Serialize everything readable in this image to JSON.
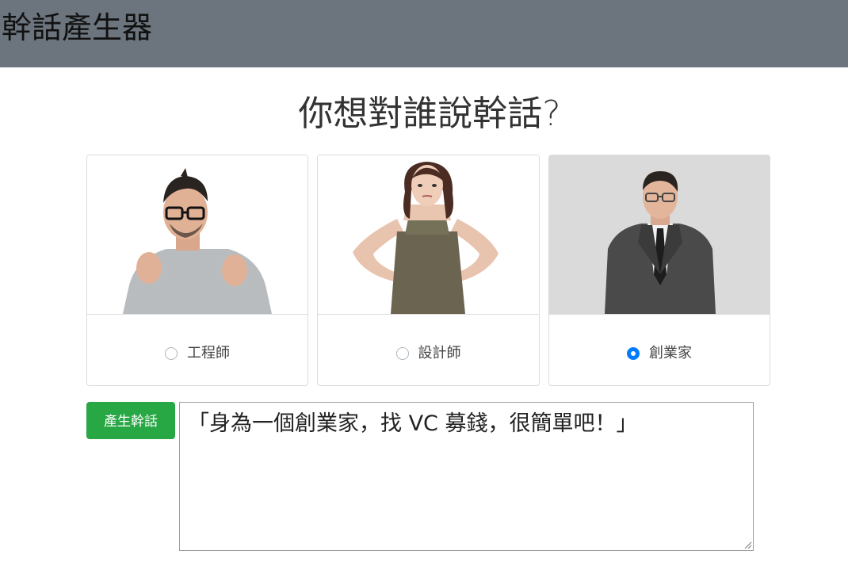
{
  "navbar": {
    "brand": "幹話產生器"
  },
  "main": {
    "heading": "你想對誰說幹話?",
    "options": [
      {
        "label": "工程師",
        "selected": false,
        "image": "engineer-photo"
      },
      {
        "label": "設計師",
        "selected": false,
        "image": "designer-photo"
      },
      {
        "label": "創業家",
        "selected": true,
        "image": "entrepreneur-photo"
      }
    ],
    "generate_label": "產生幹話",
    "output_text": "「身為一個創業家，找 VC 募錢，很簡單吧！」"
  },
  "colors": {
    "navbar_bg": "#6c757d",
    "button_bg": "#28a745",
    "radio_checked": "#007bff"
  }
}
